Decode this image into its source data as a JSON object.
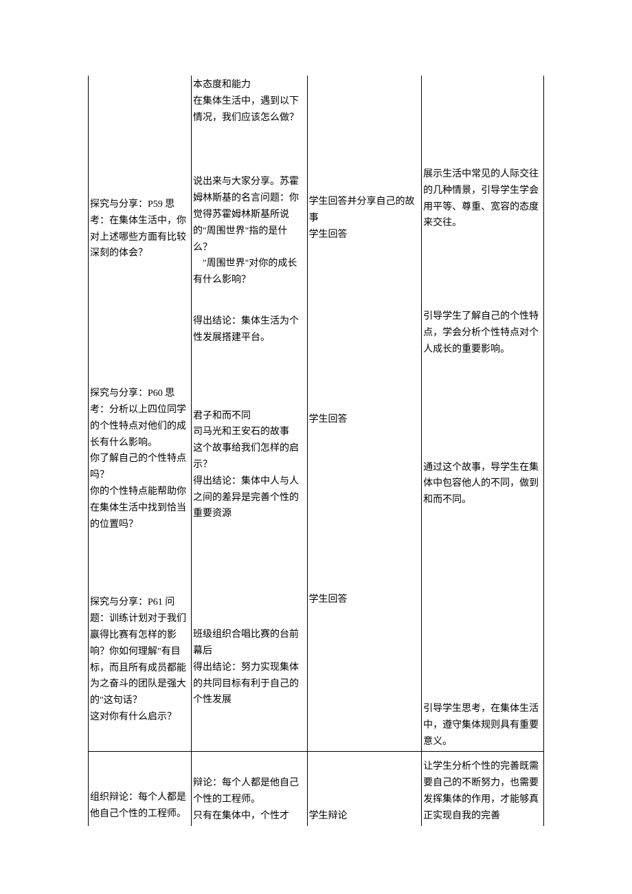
{
  "rows": [
    {
      "c1": [
        {
          "t": "",
          "gap": 174
        },
        {
          "t": "探究与分享：P59 思考：在集体生活中，你对上述哪些方面有比较深刻的体会？"
        },
        {
          "t": "",
          "gap": 180
        },
        {
          "t": "探究与分享：P60 思考：分析以上四位同学的个性特点对他们的成长有什么影响。"
        },
        {
          "t": "你了解自己的个性特点吗？"
        },
        {
          "t": "你的个性特点能帮助你在集体生活中找到恰当的位置吗？"
        },
        {
          "t": "",
          "gap": 90
        },
        {
          "t": "探究与分享：P61 问题：训练计划对于我们赢得比赛有怎样的影响？你如何理解\"有目标，而且所有成员都能为之奋斗的团队是强大的\"这句话？"
        },
        {
          "t": "这对你有什么启示？"
        }
      ],
      "c2": [
        {
          "t": "本态度和能力"
        },
        {
          "t": "在集体生活中，遇到以下情况，我们应该怎么做？"
        },
        {
          "t": "",
          "gap": 70
        },
        {
          "t": "说出来与大家分享。苏霍姆林斯基的名言问题：你觉得苏霍姆林斯基所说的\"周围世界\"指的是什么？"
        },
        {
          "t": "　\"周围世界\"对你的成长有什么影响？"
        },
        {
          "t": "",
          "gap": 36
        },
        {
          "t": "得出结论：集体生活为个性发展搭建平台。"
        },
        {
          "t": "",
          "gap": 90
        },
        {
          "t": "君子和而不同"
        },
        {
          "t": "司马光和王安石的故事"
        },
        {
          "t": "这个故事给我们怎样的启示？"
        },
        {
          "t": "得出结论：集体中人与人之间的差异是完善个性的重要资源"
        },
        {
          "t": "",
          "gap": 152
        },
        {
          "t": "班级组织合唱比赛的台前幕后"
        },
        {
          "t": "得出结论：努力实现集体的共同目标有利于自己的个性发展"
        }
      ],
      "c3": [
        {
          "t": "",
          "gap": 170
        },
        {
          "t": "学生回答并分享自己的故事"
        },
        {
          "t": "学生回答"
        },
        {
          "t": "",
          "gap": 246
        },
        {
          "t": "学生回答"
        },
        {
          "t": "",
          "gap": 238
        },
        {
          "t": "学生回答"
        }
      ],
      "c4": [
        {
          "t": "",
          "gap": 130
        },
        {
          "t": "展示生活中常见的人际交往的几种情景，引导学生学会用平等、尊重、宽容的态度来交往。"
        },
        {
          "t": "",
          "gap": 112
        },
        {
          "t": "引导学生了解自己的个性特点，学会分析个性特点对个人成长的重要影响。"
        },
        {
          "t": "",
          "gap": 148
        },
        {
          "t": "通过这个故事，导学生在集体中包容他人的不同，做到和而不同。"
        },
        {
          "t": "",
          "gap": 280
        },
        {
          "t": "引导学生思考，在集体生活中，遵守集体规则具有重要意义。"
        }
      ]
    },
    {
      "c1": [
        {
          "t": "组织辩论：每个人都是他自己个性的工程师。"
        }
      ],
      "c2": [
        {
          "t": "",
          "gap": 32
        },
        {
          "t": "辩论：每个人都是他自己个性的工程师。"
        },
        {
          "t": "只有在集体中，个性才"
        }
      ],
      "c3": [
        {
          "t": "",
          "gap": 80
        },
        {
          "t": "学生辩论"
        }
      ],
      "c4": [
        {
          "t": "",
          "gap": 8
        },
        {
          "t": "让学生分析个性的完善既需要自己的不断努力，也需要发挥集体的作用，才能够真正实现自我的完善"
        }
      ]
    }
  ]
}
